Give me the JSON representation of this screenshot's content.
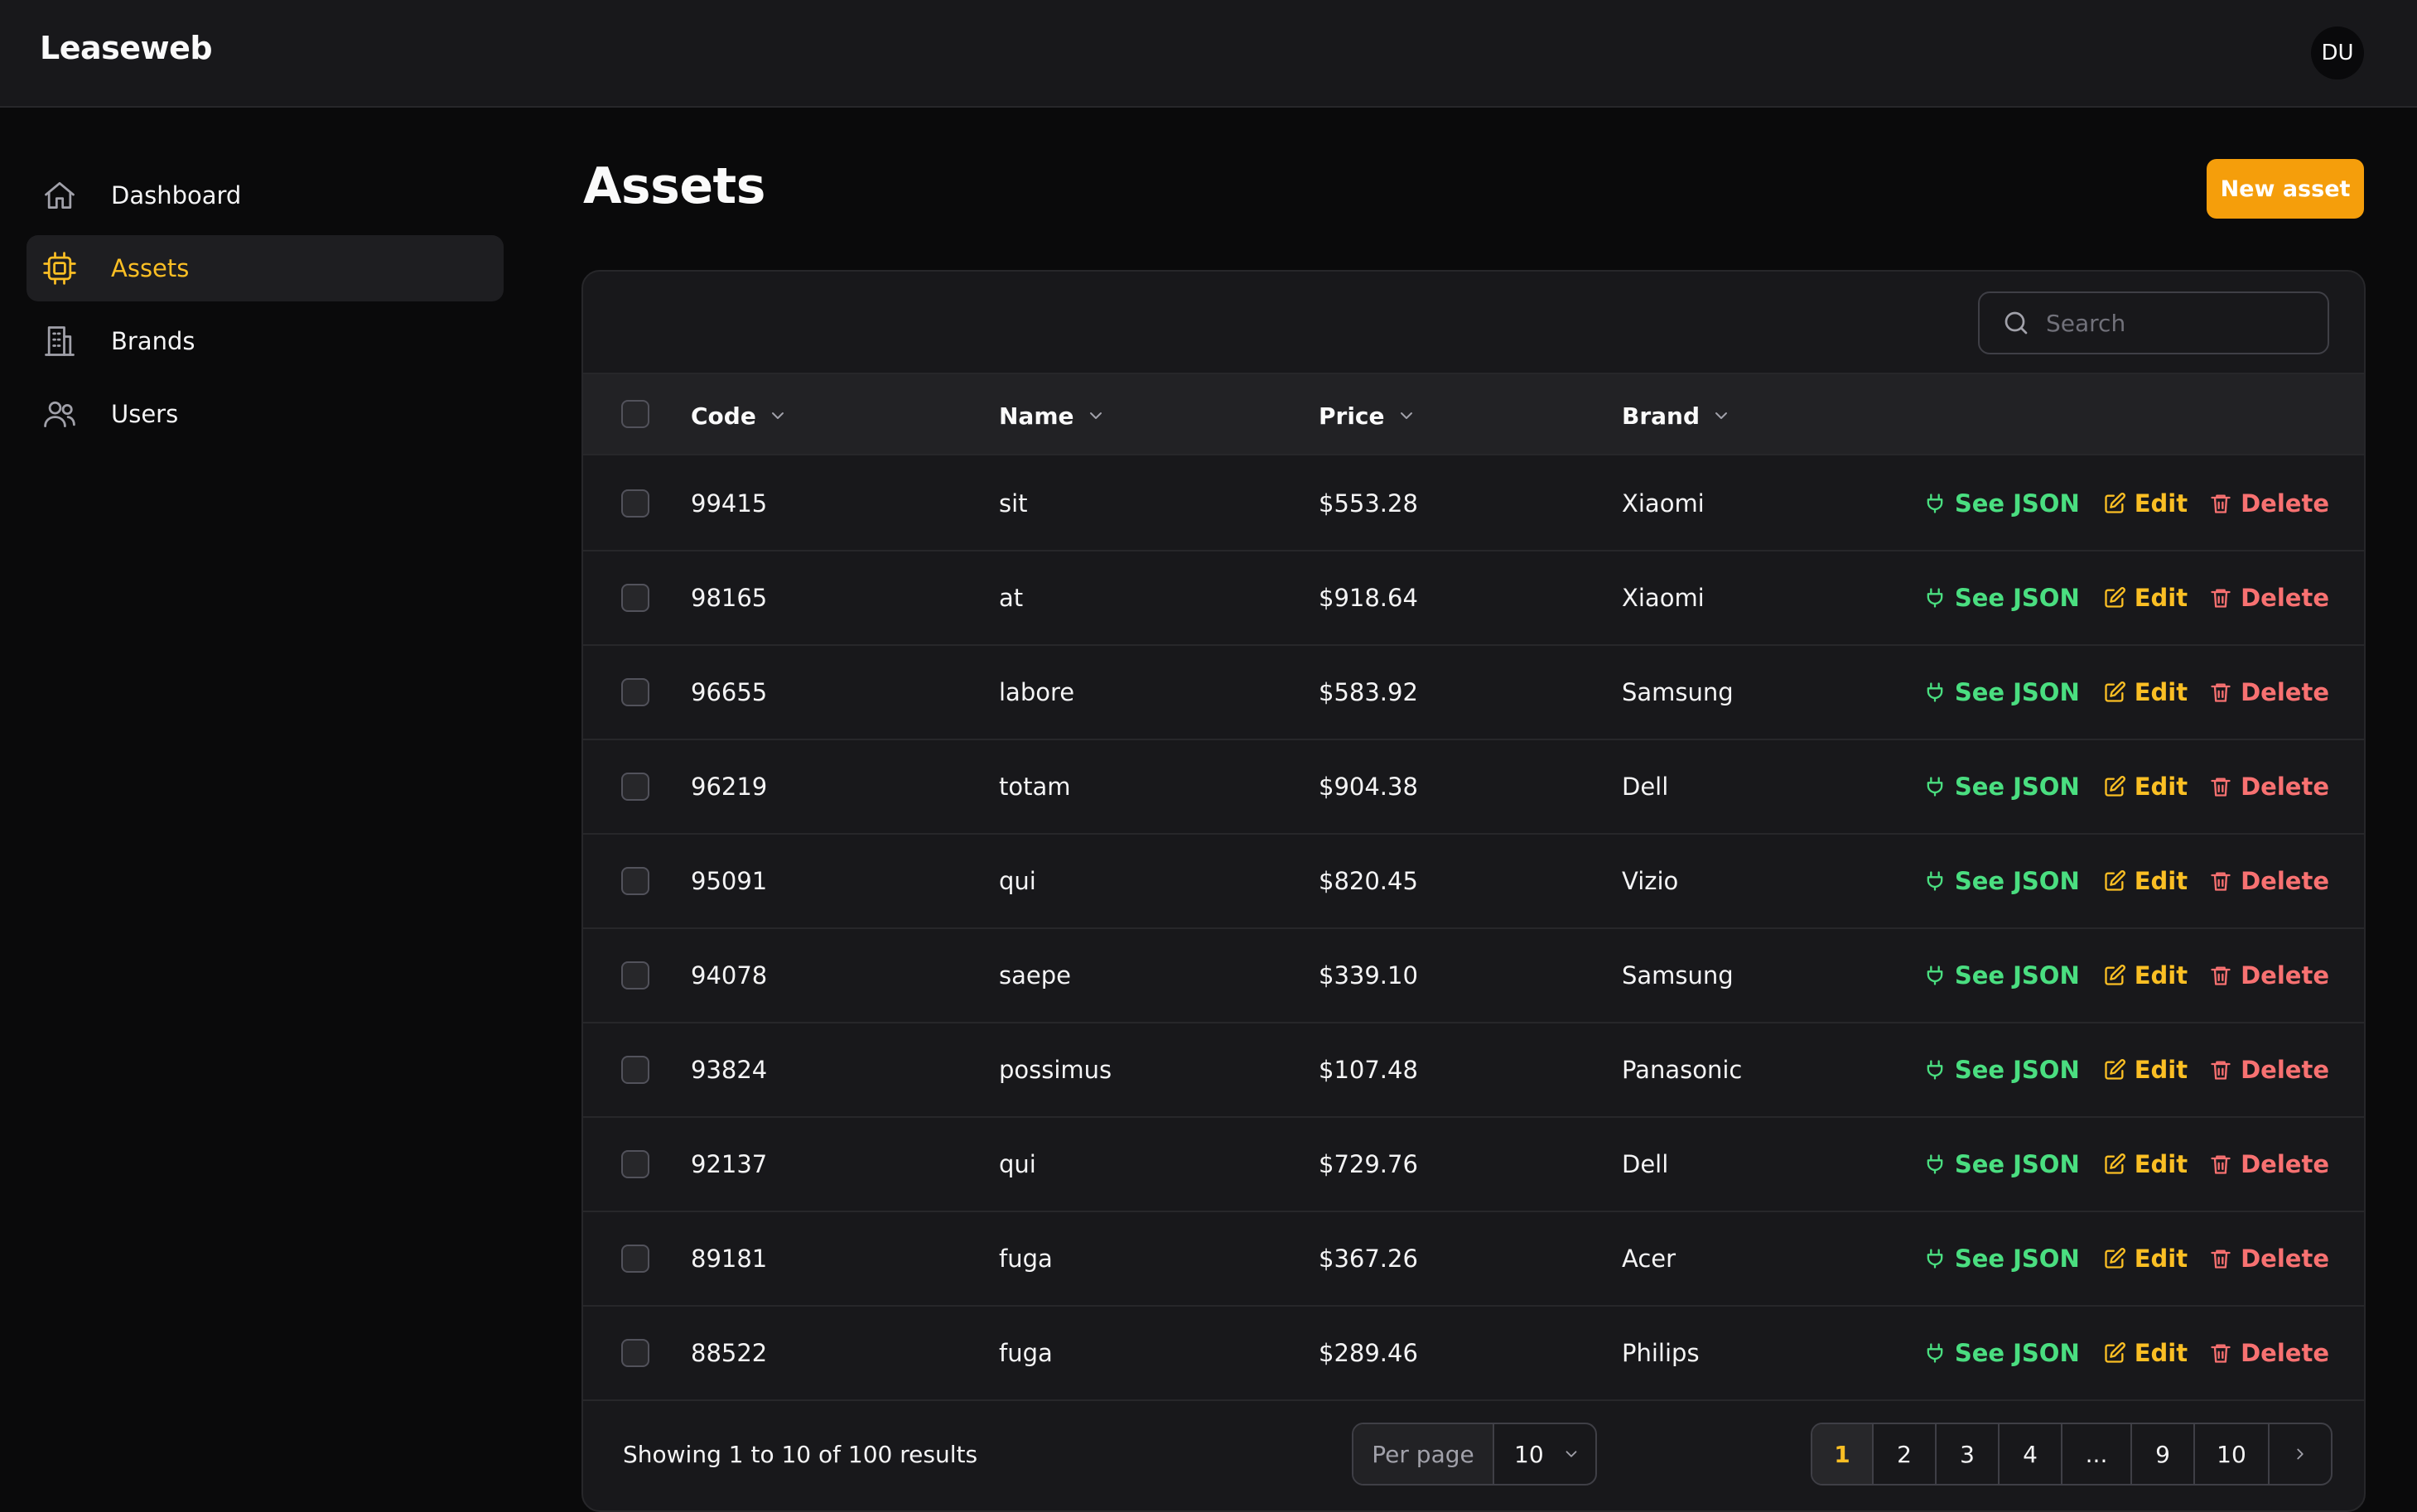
{
  "app": {
    "brand": "Leaseweb",
    "user_initials": "DU"
  },
  "sidebar": {
    "items": [
      {
        "label": "Dashboard",
        "icon": "home-icon",
        "active": false
      },
      {
        "label": "Assets",
        "icon": "cpu-chip-icon",
        "active": true
      },
      {
        "label": "Brands",
        "icon": "building-icon",
        "active": false
      },
      {
        "label": "Users",
        "icon": "users-icon",
        "active": false
      }
    ]
  },
  "page": {
    "title": "Assets",
    "new_button": "New asset"
  },
  "search": {
    "placeholder": "Search"
  },
  "table": {
    "columns": [
      "Code",
      "Name",
      "Price",
      "Brand"
    ],
    "actions": {
      "json": "See JSON",
      "edit": "Edit",
      "delete": "Delete"
    },
    "rows": [
      {
        "code": "99415",
        "name": "sit",
        "price": "$553.28",
        "brand": "Xiaomi"
      },
      {
        "code": "98165",
        "name": "at",
        "price": "$918.64",
        "brand": "Xiaomi"
      },
      {
        "code": "96655",
        "name": "labore",
        "price": "$583.92",
        "brand": "Samsung"
      },
      {
        "code": "96219",
        "name": "totam",
        "price": "$904.38",
        "brand": "Dell"
      },
      {
        "code": "95091",
        "name": "qui",
        "price": "$820.45",
        "brand": "Vizio"
      },
      {
        "code": "94078",
        "name": "saepe",
        "price": "$339.10",
        "brand": "Samsung"
      },
      {
        "code": "93824",
        "name": "possimus",
        "price": "$107.48",
        "brand": "Panasonic"
      },
      {
        "code": "92137",
        "name": "qui",
        "price": "$729.76",
        "brand": "Dell"
      },
      {
        "code": "89181",
        "name": "fuga",
        "price": "$367.26",
        "brand": "Acer"
      },
      {
        "code": "88522",
        "name": "fuga",
        "price": "$289.46",
        "brand": "Philips"
      }
    ]
  },
  "footer": {
    "showing": "Showing 1 to 10 of 100 results",
    "per_page_label": "Per page",
    "per_page_value": "10",
    "pages": [
      "1",
      "2",
      "3",
      "4",
      "...",
      "9",
      "10"
    ],
    "current_page": "1"
  },
  "colors": {
    "accent": "#f59e0b",
    "active_nav_text": "#fbbf24",
    "json_action": "#4ade80",
    "edit_action": "#fbbf24",
    "delete_action": "#f87171"
  }
}
